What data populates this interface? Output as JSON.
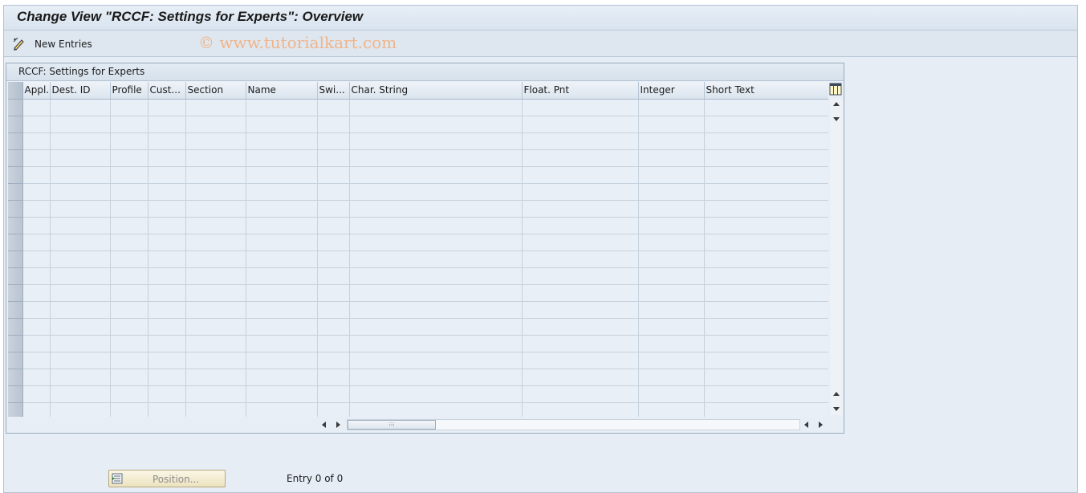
{
  "window": {
    "title": "Change View \"RCCF: Settings for Experts\": Overview"
  },
  "toolbar": {
    "new_entries_label": "New Entries",
    "watermark": "© www.tutorialkart.com"
  },
  "table": {
    "caption": "RCCF: Settings for Experts",
    "columns": [
      "Appl.",
      "Dest. ID",
      "Profile",
      "Cust...",
      "Section",
      "Name",
      "Swi...",
      "Char. String",
      "Float. Pnt",
      "Integer",
      "Short Text"
    ],
    "rows": [
      [
        "",
        "",
        "",
        "",
        "",
        "",
        "",
        "",
        "",
        "",
        ""
      ],
      [
        "",
        "",
        "",
        "",
        "",
        "",
        "",
        "",
        "",
        "",
        ""
      ],
      [
        "",
        "",
        "",
        "",
        "",
        "",
        "",
        "",
        "",
        "",
        ""
      ],
      [
        "",
        "",
        "",
        "",
        "",
        "",
        "",
        "",
        "",
        "",
        ""
      ],
      [
        "",
        "",
        "",
        "",
        "",
        "",
        "",
        "",
        "",
        "",
        ""
      ],
      [
        "",
        "",
        "",
        "",
        "",
        "",
        "",
        "",
        "",
        "",
        ""
      ],
      [
        "",
        "",
        "",
        "",
        "",
        "",
        "",
        "",
        "",
        "",
        ""
      ],
      [
        "",
        "",
        "",
        "",
        "",
        "",
        "",
        "",
        "",
        "",
        ""
      ],
      [
        "",
        "",
        "",
        "",
        "",
        "",
        "",
        "",
        "",
        "",
        ""
      ],
      [
        "",
        "",
        "",
        "",
        "",
        "",
        "",
        "",
        "",
        "",
        ""
      ],
      [
        "",
        "",
        "",
        "",
        "",
        "",
        "",
        "",
        "",
        "",
        ""
      ],
      [
        "",
        "",
        "",
        "",
        "",
        "",
        "",
        "",
        "",
        "",
        ""
      ],
      [
        "",
        "",
        "",
        "",
        "",
        "",
        "",
        "",
        "",
        "",
        ""
      ],
      [
        "",
        "",
        "",
        "",
        "",
        "",
        "",
        "",
        "",
        "",
        ""
      ],
      [
        "",
        "",
        "",
        "",
        "",
        "",
        "",
        "",
        "",
        "",
        ""
      ],
      [
        "",
        "",
        "",
        "",
        "",
        "",
        "",
        "",
        "",
        "",
        ""
      ],
      [
        "",
        "",
        "",
        "",
        "",
        "",
        "",
        "",
        "",
        "",
        ""
      ],
      [
        "",
        "",
        "",
        "",
        "",
        "",
        "",
        "",
        "",
        "",
        ""
      ],
      [
        "",
        "",
        "",
        "",
        "",
        "",
        "",
        "",
        "",
        "",
        ""
      ]
    ]
  },
  "footer": {
    "position_label": "Position...",
    "entry_info": "Entry 0 of 0"
  },
  "icons": {
    "new_entries": "pencil-new-icon",
    "column_settings": "column-settings-icon",
    "position": "position-icon"
  }
}
